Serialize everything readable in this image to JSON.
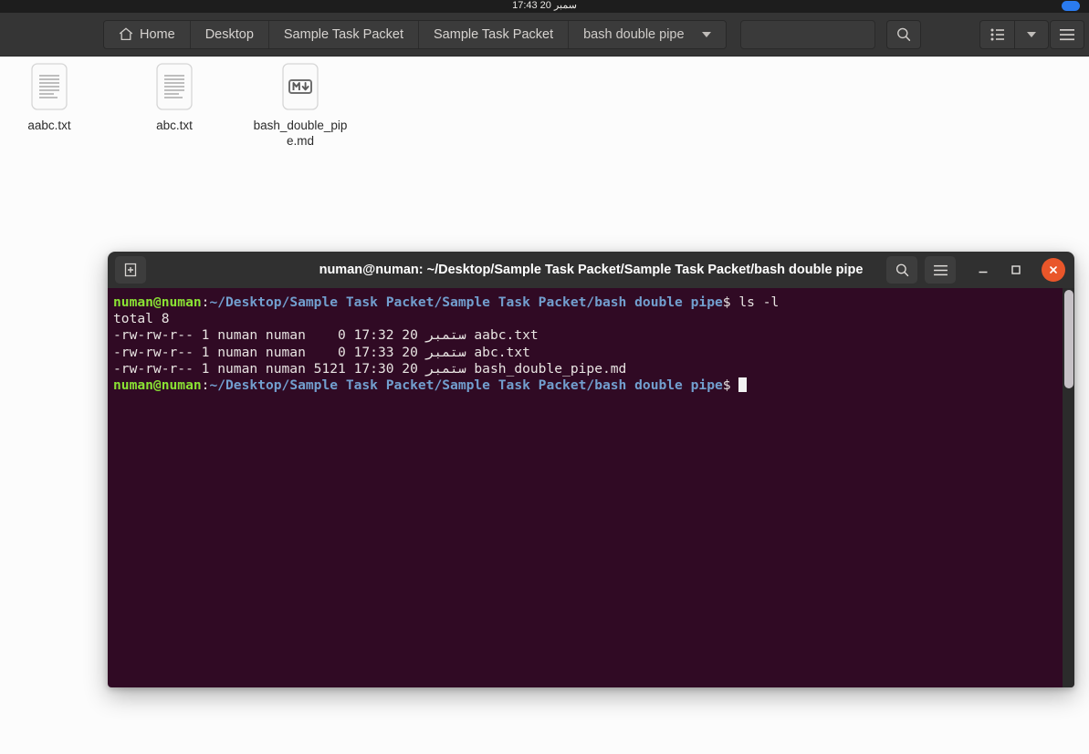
{
  "topbar": {
    "clock": "17:43  20 سمبر",
    "tray_icon": "network-indicator"
  },
  "file_manager": {
    "breadcrumbs": [
      {
        "label": "Home",
        "icon": "home-icon"
      },
      {
        "label": "Desktop",
        "icon": ""
      },
      {
        "label": "Sample Task Packet",
        "icon": ""
      },
      {
        "label": "Sample Task Packet",
        "icon": ""
      },
      {
        "label": "bash double pipe",
        "icon": "chevron-down-icon"
      }
    ],
    "search_placeholder": "",
    "search_value": "",
    "toolbar": {
      "search_icon": "search-icon",
      "view_list_icon": "list-view-icon",
      "view_dropdown_icon": "chevron-down-icon",
      "menu_icon": "hamburger-menu-icon"
    },
    "files": [
      {
        "name": "aabc.txt",
        "type": "text",
        "icon": "text-file-icon"
      },
      {
        "name": "abc.txt",
        "type": "text",
        "icon": "text-file-icon"
      },
      {
        "name": "bash_double_pipe.md",
        "type": "markdown",
        "icon": "markdown-file-icon",
        "badge": "M↓"
      }
    ]
  },
  "terminal": {
    "title": "numan@numan: ~/Desktop/Sample Task Packet/Sample Task Packet/bash double pipe",
    "titlebar": {
      "new_tab_icon": "new-tab-icon",
      "search_icon": "search-icon",
      "menu_icon": "hamburger-menu-icon",
      "minimize_icon": "minimize-icon",
      "maximize_icon": "maximize-icon",
      "close_icon": "close-icon"
    },
    "colors": {
      "background": "#300a24",
      "titlebar": "#303030",
      "close_button": "#e9562a",
      "prompt_user": "#8ae234",
      "prompt_path": "#729fcf",
      "foreground": "#e8e4e2"
    },
    "prompt": {
      "user_host": "numan@numan",
      "path": "~/Desktop/Sample Task Packet/Sample Task Packet/bash double pipe",
      "symbol": "$"
    },
    "command": " ls -l",
    "output_lines": [
      "total 8",
      "-rw-rw-r-- 1 numan numan    0 17:32 20 ستمبر aabc.txt",
      "-rw-rw-r-- 1 numan numan    0 17:33 20 ستمبر abc.txt",
      "-rw-rw-r-- 1 numan numan 5121 17:30 20 ستمبر bash_double_pipe.md"
    ],
    "listing": {
      "total": "total 8",
      "rows": [
        {
          "permissions": "-rw-rw-r--",
          "links": "1",
          "owner": "numan",
          "group": "numan",
          "size": "0",
          "time": "17:32",
          "day": "20",
          "month": "ستمبر",
          "name": "aabc.txt"
        },
        {
          "permissions": "-rw-rw-r--",
          "links": "1",
          "owner": "numan",
          "group": "numan",
          "size": "0",
          "time": "17:33",
          "day": "20",
          "month": "ستمبر",
          "name": "abc.txt"
        },
        {
          "permissions": "-rw-rw-r--",
          "links": "1",
          "owner": "numan",
          "group": "numan",
          "size": "5121",
          "time": "17:30",
          "day": "20",
          "month": "ستمبر",
          "name": "bash_double_pipe.md"
        }
      ]
    }
  }
}
